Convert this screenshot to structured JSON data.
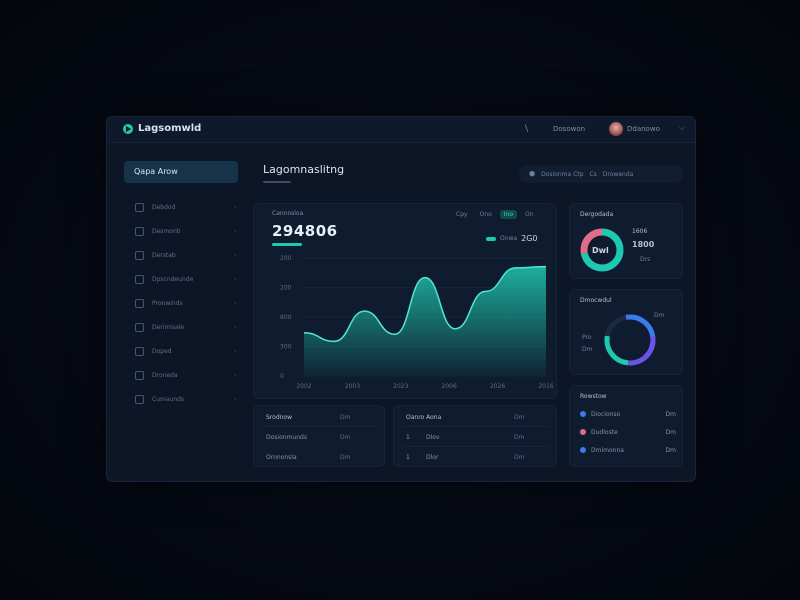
{
  "app": {
    "name": "Lagsomwld"
  },
  "topbar": {
    "search_glyph": "\\",
    "link": "Dosowon",
    "user_name": "Ddanowo",
    "chevron": "⌵"
  },
  "sidebar": {
    "primary": "Qapa Arow",
    "items": [
      {
        "label": "Debdod",
        "chevron": "›"
      },
      {
        "label": "Desmonb",
        "chevron": "›"
      },
      {
        "label": "Derstab",
        "chevron": "›"
      },
      {
        "label": "Dpscndeunde",
        "chevron": "›"
      },
      {
        "label": "Pronwinds",
        "chevron": "›"
      },
      {
        "label": "Derimisale",
        "chevron": "›"
      },
      {
        "label": "Doped",
        "chevron": "›"
      },
      {
        "label": "Droneda",
        "chevron": "›"
      },
      {
        "label": "Cumaunds",
        "chevron": "›"
      }
    ]
  },
  "header": {
    "title": "Lagomnaslitng",
    "actions": {
      "icon1": "⬢",
      "label1": "Doslonma Ctp",
      "label2": "Cs",
      "label3": "Drowenda"
    }
  },
  "chart_card": {
    "label": "Cannosloa",
    "value": "294806",
    "range_buttons": [
      "Cpy",
      "Ono",
      "Ino",
      "On"
    ],
    "active_range": 2,
    "legend_text": "Onwa",
    "legend_value": "2G0"
  },
  "chart_data": {
    "type": "area",
    "x": [
      "2002",
      "2003",
      "2023",
      "2006",
      "2026",
      "2016"
    ],
    "y_ticks": [
      "200",
      "200",
      "800",
      "300",
      "0"
    ],
    "values": [
      110,
      88,
      165,
      106,
      250,
      120,
      215,
      275,
      278
    ],
    "color": "#1fc8b0",
    "grid": true
  },
  "sub_card_a": {
    "title": "Srodnow",
    "title_r": "Dm",
    "rows": [
      {
        "label": "Dosionmunds",
        "value": "Dm"
      },
      {
        "label": "Ornnonsla",
        "value": "Dm"
      }
    ]
  },
  "sub_card_b": {
    "title": "Oanro Aona",
    "title_r": "Dm",
    "rows": [
      {
        "idx": "1",
        "label": "Dlov",
        "value": "Dm"
      },
      {
        "idx": "1",
        "label": "Dlor",
        "value": "Dm"
      }
    ]
  },
  "donut1": {
    "title": "Dergodada",
    "center": "Dwl",
    "stat_1": "1606",
    "stat_2": "1800",
    "side": "Drs",
    "percent": 0.72,
    "color_a": "#1fc8b0",
    "color_b": "#e06c8c"
  },
  "donut2": {
    "title": "Dmocwdul",
    "side_top": "Dm",
    "side_mid": "Pro",
    "side_bot": "Dm",
    "color_a": "#3b7bf0",
    "color_b": "#6a54e8",
    "color_c": "#1fc8b0"
  },
  "list_card": {
    "title": "Rowstow",
    "rows": [
      {
        "label": "Diocionso",
        "value": "Dm",
        "dot": "#3b7bf0"
      },
      {
        "label": "Dudloste",
        "value": "Dm",
        "dot": "#e06c8c"
      },
      {
        "label": "Dmimonna",
        "value": "Dm",
        "dot": "#3b7bf0"
      }
    ]
  }
}
